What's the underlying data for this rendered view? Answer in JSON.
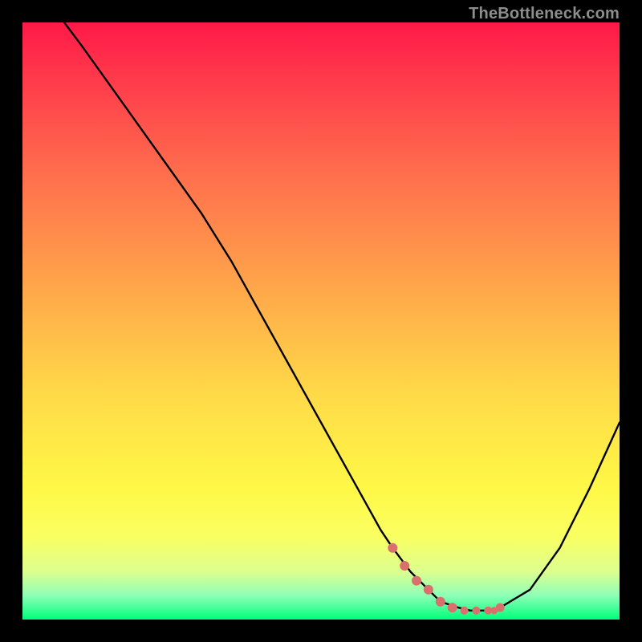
{
  "watermark": "TheBottleneck.com",
  "colors": {
    "curve": "#000000",
    "marker": "#d9706c",
    "background_frame_start": "#ff1948",
    "background_frame_end": "#00ff7a",
    "page_bg": "#000000",
    "watermark": "#8d8d8d"
  },
  "chart_data": {
    "type": "line",
    "title": "",
    "xlabel": "",
    "ylabel": "",
    "xlim": [
      0,
      100
    ],
    "ylim": [
      0,
      100
    ],
    "grid": false,
    "legend": false,
    "series": [
      {
        "name": "bottleneck-curve",
        "x": [
          7,
          10,
          15,
          20,
          25,
          30,
          35,
          40,
          45,
          50,
          55,
          60,
          62,
          65,
          68,
          70,
          73,
          75,
          78,
          80,
          85,
          90,
          95,
          100
        ],
        "values": [
          100,
          96,
          89,
          82,
          75,
          68,
          60,
          51,
          42,
          33,
          24,
          15,
          12,
          8,
          5,
          3,
          2,
          1.5,
          1.5,
          2,
          5,
          12,
          22,
          33
        ]
      }
    ],
    "markers": {
      "name": "optimal-range",
      "x": [
        62,
        64,
        66,
        68,
        70,
        72,
        74,
        76,
        78,
        79,
        80
      ],
      "values": [
        12,
        9,
        6.5,
        5,
        3,
        2,
        1.5,
        1.5,
        1.5,
        1.5,
        2
      ],
      "radius": [
        6,
        6,
        6,
        6,
        6,
        6,
        5,
        5,
        5,
        4.5,
        5.5
      ]
    }
  }
}
